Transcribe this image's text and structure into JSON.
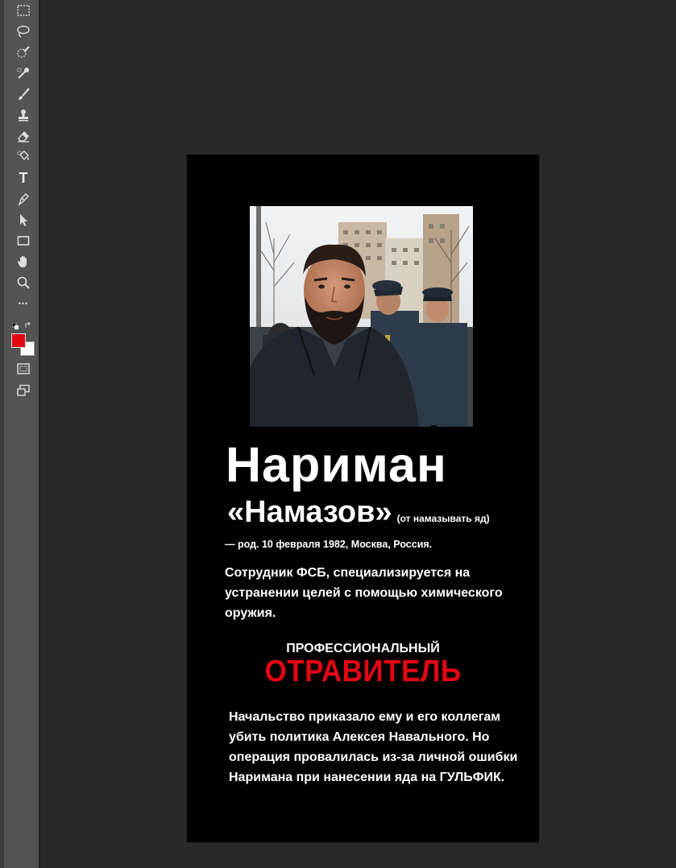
{
  "toolbar": {
    "tools": [
      {
        "name": "marquee-tool-icon",
        "glyph": ""
      },
      {
        "name": "lasso-tool-icon",
        "glyph": ""
      },
      {
        "name": "quick-selection-tool-icon",
        "glyph": ""
      },
      {
        "name": "eyedropper-tool-icon",
        "glyph": ""
      },
      {
        "name": "brush-tool-icon",
        "glyph": ""
      },
      {
        "name": "clone-stamp-tool-icon",
        "glyph": ""
      },
      {
        "name": "eraser-tool-icon",
        "glyph": ""
      },
      {
        "name": "paint-bucket-tool-icon",
        "glyph": ""
      },
      {
        "name": "type-tool-icon",
        "glyph": "T"
      },
      {
        "name": "pen-tool-icon",
        "glyph": ""
      },
      {
        "name": "path-selection-tool-icon",
        "glyph": ""
      },
      {
        "name": "rectangle-tool-icon",
        "glyph": ""
      },
      {
        "name": "hand-tool-icon",
        "glyph": ""
      },
      {
        "name": "zoom-tool-icon",
        "glyph": ""
      },
      {
        "name": "more-tools-icon",
        "glyph": "•••"
      }
    ],
    "foreground_color": "#e30613",
    "background_color": "#ffffff"
  },
  "document": {
    "background": "#000000",
    "first_name": "Нариман",
    "surname": "«Намазов»",
    "surname_note": "(от намазывать яд)",
    "birth_line": "— род. 10 февраля 1982, Москва, Россия.",
    "role_text": "Сотрудник ФСБ, специализируется на устранении целей с помощью химического оружия.",
    "professional_label": "ПРОФЕССИОНАЛЬНЫЙ",
    "poisoner_label": "ОТРАВИТЕЛЬ",
    "story_text": "Начальство приказало ему и его коллегам убить политика Алексея Навального. Но операция провалилась из-за личной ошибки Наримана при нанесении яда на ГУЛЬФИК.",
    "accent_color": "#e30613"
  }
}
